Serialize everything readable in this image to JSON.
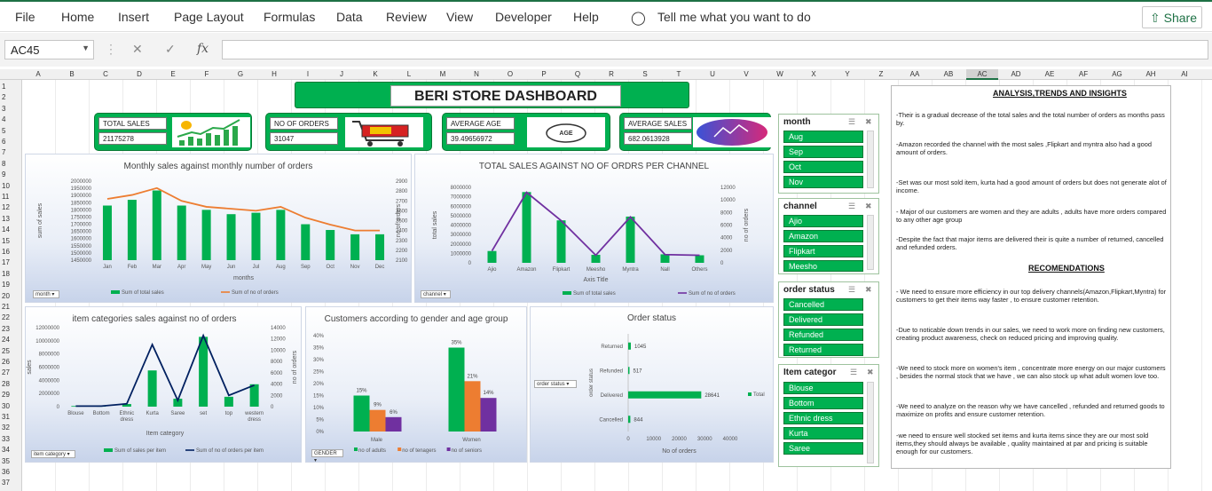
{
  "menu": {
    "file": "File",
    "home": "Home",
    "insert": "Insert",
    "page_layout": "Page Layout",
    "formulas": "Formulas",
    "data": "Data",
    "review": "Review",
    "view": "View",
    "developer": "Developer",
    "help": "Help",
    "tell_me": "Tell me what you want to do",
    "share": "Share"
  },
  "formula_bar": {
    "name_box": "AC45",
    "fx": "fx",
    "formula": ""
  },
  "columns": [
    "A",
    "B",
    "C",
    "D",
    "E",
    "F",
    "G",
    "H",
    "I",
    "J",
    "K",
    "L",
    "M",
    "N",
    "O",
    "P",
    "Q",
    "R",
    "S",
    "T",
    "U",
    "V",
    "W",
    "X",
    "Y",
    "Z",
    "AA",
    "AB",
    "AC",
    "AD",
    "AE",
    "AF",
    "AG",
    "AH",
    "AI"
  ],
  "rows": [
    "1",
    "2",
    "3",
    "4",
    "5",
    "6",
    "7",
    "8",
    "9",
    "10",
    "11",
    "12",
    "13",
    "14",
    "15",
    "16",
    "17",
    "18",
    "19",
    "20",
    "21",
    "22",
    "23",
    "24",
    "25",
    "26",
    "27",
    "28",
    "29",
    "30",
    "31",
    "32",
    "33",
    "34",
    "35",
    "36",
    "37"
  ],
  "dashboard": {
    "title": "BERI STORE DASHBOARD",
    "kpis": [
      {
        "label": "TOTAL SALES",
        "value": "21175278"
      },
      {
        "label": "NO OF ORDERS",
        "value": "31047"
      },
      {
        "label": "AVERAGE AGE",
        "value": "39.49656972",
        "icon_text": "AGE"
      },
      {
        "label": "AVERAGE SALES",
        "value": "682.0613928"
      }
    ]
  },
  "chart_data": [
    {
      "type": "bar+line",
      "title": "Monthly sales against monthly number of orders",
      "xlabel": "months",
      "ylabel": "sum of sales",
      "y2label": "no of orders",
      "categories": [
        "Jan",
        "Feb",
        "Mar",
        "Apr",
        "May",
        "Jun",
        "Jul",
        "Aug",
        "Sep",
        "Oct",
        "Nov",
        "Dec"
      ],
      "ylim": [
        1450000,
        2000000
      ],
      "yticks": [
        "2000000",
        "1950000",
        "1900000",
        "1850000",
        "1800000",
        "1750000",
        "1700000",
        "1650000",
        "1600000",
        "1550000",
        "1500000",
        "1450000"
      ],
      "y2lim": [
        2100,
        2900
      ],
      "y2ticks": [
        "2900",
        "2800",
        "2700",
        "2600",
        "2500",
        "2400",
        "2300",
        "2200",
        "2100"
      ],
      "series": [
        {
          "name": "Sum of total sales",
          "axis": "left",
          "kind": "bar",
          "color": "#00b050",
          "values": [
            1830000,
            1870000,
            1935000,
            1830000,
            1800000,
            1770000,
            1780000,
            1800000,
            1700000,
            1660000,
            1630000,
            1630000
          ]
        },
        {
          "name": "Sum of no of orders",
          "axis": "right",
          "kind": "line",
          "color": "#ed7d31",
          "values": [
            2720,
            2760,
            2830,
            2700,
            2640,
            2620,
            2600,
            2640,
            2530,
            2460,
            2400,
            2400
          ]
        }
      ],
      "filter": "month"
    },
    {
      "type": "bar+line",
      "title": "TOTAL SALES AGAINST NO OF ORDRS PER CHANNEL",
      "xlabel": "Axis Title",
      "ylabel": "total sales",
      "y2label": "no of orders",
      "categories": [
        "Ajio",
        "Amazon",
        "Flipkart",
        "Meesho",
        "Myntra",
        "Nall",
        "Others"
      ],
      "ylim": [
        0,
        8000000
      ],
      "yticks": [
        "8000000",
        "7000000",
        "6000000",
        "5000000",
        "4000000",
        "3000000",
        "2000000",
        "1000000",
        "0"
      ],
      "y2lim": [
        0,
        12000
      ],
      "y2ticks": [
        "12000",
        "10000",
        "8000",
        "6000",
        "4000",
        "2000",
        "0"
      ],
      "series": [
        {
          "name": "Sum of total sales",
          "axis": "left",
          "kind": "bar",
          "color": "#00b050",
          "values": [
            1250000,
            7500000,
            4500000,
            850000,
            4900000,
            900000,
            800000
          ]
        },
        {
          "name": "Sum of no of orders",
          "axis": "right",
          "kind": "line",
          "color": "#7030a0",
          "values": [
            1900,
            11200,
            6700,
            1200,
            7300,
            1300,
            1200
          ]
        }
      ],
      "filter": "channel"
    },
    {
      "type": "bar+line",
      "title": "item categories sales against no of orders",
      "xlabel": "Item category",
      "ylabel": "sales",
      "y2label": "no of orders",
      "categories": [
        "Blouse",
        "Bottom",
        "Ethnic dress",
        "Kurta",
        "Saree",
        "set",
        "top",
        "western dress"
      ],
      "ylim": [
        0,
        12000000
      ],
      "yticks": [
        "12000000",
        "10000000",
        "8000000",
        "6000000",
        "4000000",
        "2000000",
        "0"
      ],
      "y2lim": [
        0,
        14000
      ],
      "y2ticks": [
        "14000",
        "12000",
        "10000",
        "8000",
        "6000",
        "4000",
        "2000",
        "0"
      ],
      "series": [
        {
          "name": "Sum of sales per item",
          "axis": "left",
          "kind": "bar",
          "color": "#00b050",
          "values": [
            100000,
            100000,
            400000,
            5500000,
            1200000,
            10600000,
            1500000,
            3400000
          ]
        },
        {
          "name": "Sum of no of orders per item",
          "axis": "right",
          "kind": "line",
          "color": "#002060",
          "values": [
            100,
            100,
            500,
            11000,
            1100,
            12600,
            2000,
            3800
          ]
        }
      ],
      "filter": "item category"
    },
    {
      "type": "bar",
      "title": "Customers according to gender and age group",
      "categories": [
        "Male",
        "Women"
      ],
      "ylim": [
        0,
        0.4
      ],
      "yticks": [
        "40%",
        "35%",
        "30%",
        "25%",
        "20%",
        "15%",
        "10%",
        "5%",
        "0%"
      ],
      "series": [
        {
          "name": "no of adults",
          "color": "#00b050",
          "values": [
            0.15,
            0.35
          ],
          "labels": [
            "15%",
            "35%"
          ]
        },
        {
          "name": "no of tenagers",
          "color": "#ed7d31",
          "values": [
            0.09,
            0.21
          ],
          "labels": [
            "9%",
            "21%"
          ]
        },
        {
          "name": "no of seniors",
          "color": "#7030a0",
          "values": [
            0.06,
            0.14
          ],
          "labels": [
            "6%",
            "14%"
          ]
        }
      ],
      "filter": "GENDER"
    },
    {
      "type": "horizontal-bar",
      "title": "Order status",
      "xlabel": "No of orders",
      "ylabel": "order status",
      "categories": [
        "Returned",
        "Refunded",
        "Delivered",
        "Cancelled"
      ],
      "xlim": [
        0,
        40000
      ],
      "xticks": [
        "0",
        "10000",
        "20000",
        "30000",
        "40000"
      ],
      "series": [
        {
          "name": "Total",
          "color": "#00b050",
          "values": [
            1045,
            517,
            28641,
            844
          ]
        }
      ],
      "filter": "order status"
    }
  ],
  "slicers": [
    {
      "title": "month",
      "items": [
        "Aug",
        "Sep",
        "Oct",
        "Nov"
      ]
    },
    {
      "title": "channel",
      "items": [
        "Ajio",
        "Amazon",
        "Flipkart",
        "Meesho"
      ]
    },
    {
      "title": "order status",
      "items": [
        "Cancelled",
        "Delivered",
        "Refunded",
        "Returned"
      ]
    },
    {
      "title": "Item categor",
      "items": [
        "Blouse",
        "Bottom",
        "Ethnic dress",
        "Kurta",
        "Saree"
      ]
    }
  ],
  "notes": {
    "heading": "ANALYSIS,TRENDS AND INSIGHTS",
    "insights": [
      "-Their is a gradual decrease of the total sales and the total number of orders as months pass by.",
      "-Amazon recorded the channel with the most sales ,Flipkart and myntra also had a good amount of orders.",
      "-Set was our most sold item, kurta had a good amount of orders but does not generate alot of income.",
      "- Major of our customers are women and they are adults , adults have more orders compared to any other age group",
      "-Despite the fact that major items are delivered their is quite a number of returned, cancelled and refunded orders."
    ],
    "rec_heading": "RECOMENDATIONS",
    "recommendations": [
      "- We need to ensure more efficiency in our top delivery channels(Amazon,Flipkart,Myntra) for customers to get their items way faster , to ensure customer retention.",
      "-Due to noticable down trends in our sales, we need to work more on finding new customers, creating product awareness, check on reduced pricing and improving quality.",
      "-We need to stock more on women's item , concentrate more energy on our major customers , besides the normal stock that we have , we can also stock up what adult women love too.",
      "-We need to analyze on the reason why we have cancelled , refunded and returned goods to maximize on profits and ensure customer retention.",
      "-we need to ensure well stocked set items and kurta items since they are our most sold items,they should always be available , quality maintained at par and pricing is suitable enough for our customers."
    ]
  }
}
